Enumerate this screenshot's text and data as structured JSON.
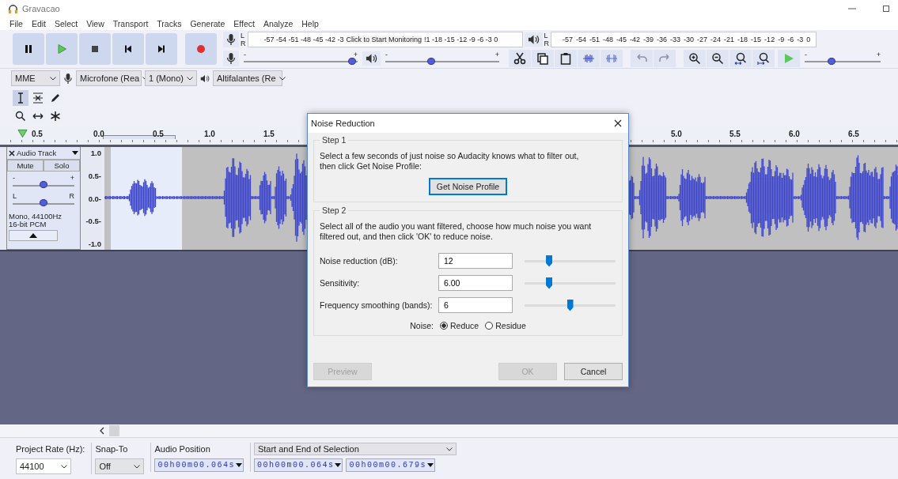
{
  "window": {
    "title": "Gravacao"
  },
  "menu": [
    "File",
    "Edit",
    "Select",
    "View",
    "Transport",
    "Tracks",
    "Generate",
    "Effect",
    "Analyze",
    "Help"
  ],
  "record_meter": {
    "channels": [
      "L",
      "R"
    ],
    "scale_left": "-57 -54 -51 -48 -45 -42 -3",
    "prompt": "Click to Start Monitoring",
    "scale_right": "!1 -18 -15 -12 -9 -6 -3 0"
  },
  "playback_meter": {
    "channels": [
      "L",
      "R"
    ],
    "scale": "-57 -54 -51 -48 -45 -42 -39 -36 -33 -30 -27 -24 -21 -18 -15 -12 -9 -6 -3 0"
  },
  "record_volume": {
    "minus": "-",
    "plus": "+",
    "level": 0.95
  },
  "playback_volume": {
    "minus": "-",
    "plus": "+",
    "level": 0.4
  },
  "play_at_speed": {
    "minus": "-",
    "plus": "+",
    "level": 0.35
  },
  "devices": {
    "host": "MME",
    "input": "Microfone (Rea",
    "channels": "1 (Mono)",
    "output": "Altifalantes (Re"
  },
  "ruler": {
    "start": "0.5",
    "labels": [
      "0.0",
      "0.5",
      "1.0",
      "1.5",
      "5.0",
      "5.5",
      "6.0",
      "6.5"
    ]
  },
  "track": {
    "name": "Audio Track",
    "mute": "Mute",
    "solo": "Solo",
    "gain": {
      "minus": "-",
      "plus": "+",
      "level": 0.5
    },
    "pan": {
      "left": "L",
      "right": "R",
      "level": 0.5
    },
    "info": "Mono, 44100Hz\n16-bit PCM",
    "scale": [
      "1.0",
      "0.5-",
      "0.0-",
      "-0.5-",
      "-1.0"
    ]
  },
  "dialog": {
    "title": "Noise Reduction",
    "step1": {
      "legend": "Step 1",
      "text": "Select a few seconds of just noise so Audacity knows what to filter out,\nthen click Get Noise Profile:",
      "button": "Get Noise Profile"
    },
    "step2": {
      "legend": "Step 2",
      "text": "Select all of the audio you want filtered, choose how much noise you want\nfiltered out, and then click 'OK' to reduce noise.",
      "fields": [
        {
          "label": "Noise reduction (dB):",
          "value": "12",
          "level": 0.27
        },
        {
          "label": "Sensitivity:",
          "value": "6.00",
          "level": 0.27
        },
        {
          "label": "Frequency smoothing (bands):",
          "value": "6",
          "level": 0.5
        }
      ],
      "noise_label": "Noise:",
      "options": [
        {
          "label": "Reduce",
          "selected": true
        },
        {
          "label": "Residue",
          "selected": false
        }
      ]
    },
    "buttons": [
      {
        "label": "Preview",
        "disabled": true
      },
      {
        "label": "OK",
        "disabled": true
      },
      {
        "label": "Cancel",
        "disabled": false
      }
    ]
  },
  "selection_toolbar": {
    "project_rate": {
      "label": "Project Rate (Hz):",
      "value": "44100"
    },
    "snap_to": {
      "label": "Snap-To",
      "value": "Off"
    },
    "audio_position": {
      "label": "Audio Position",
      "value": "00h00m00.064s"
    },
    "selection": {
      "label": "Start and End of Selection",
      "start": "00h00m00.064s",
      "end": "00h00m00.679s"
    }
  }
}
